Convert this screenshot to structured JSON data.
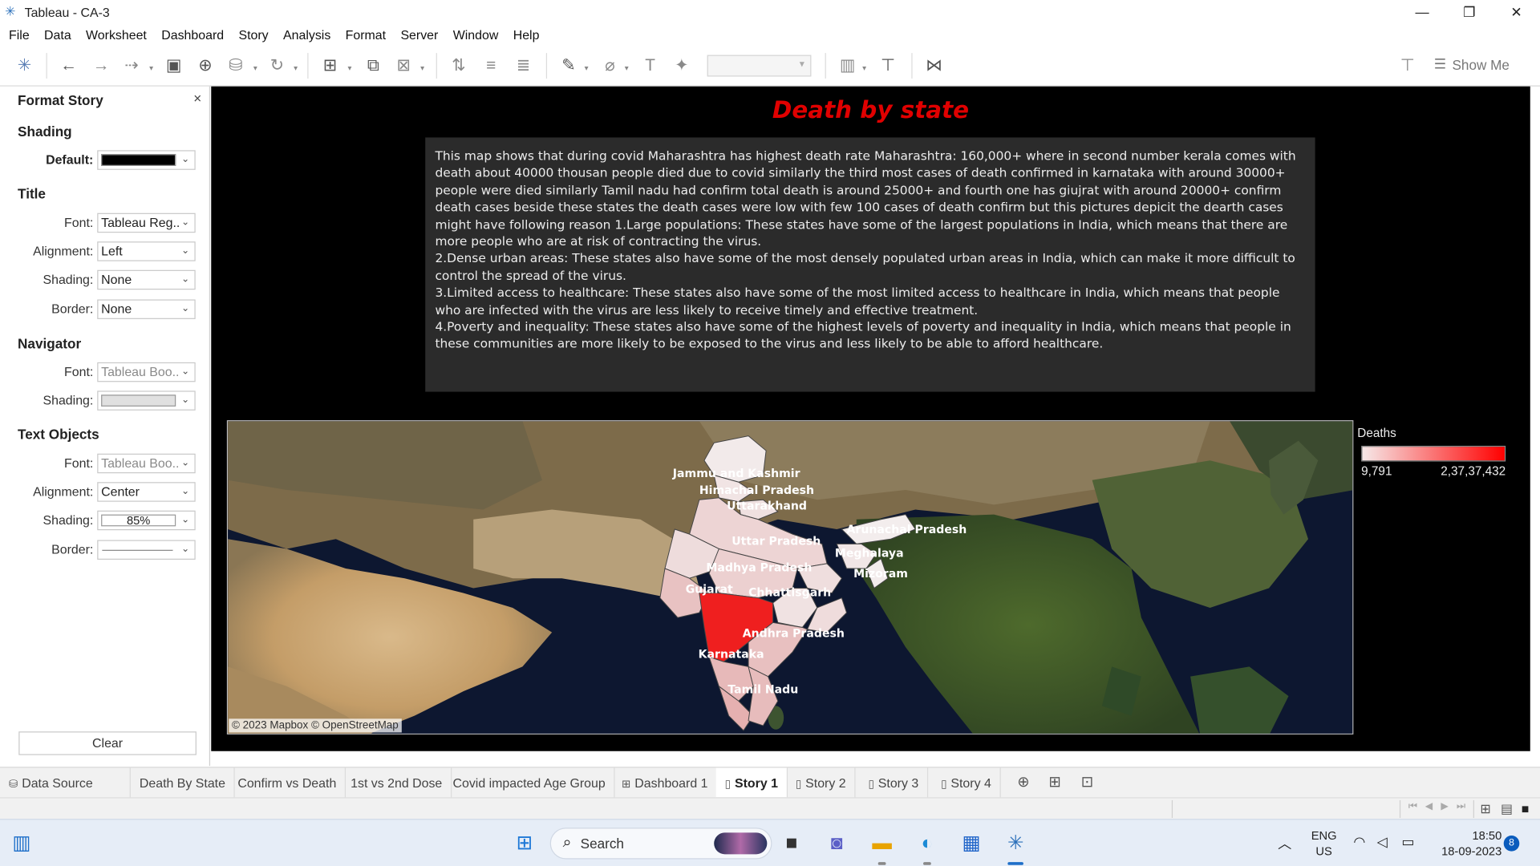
{
  "window": {
    "title": "Tableau - CA-3",
    "controls": [
      "—",
      "❐",
      "✕"
    ]
  },
  "menu": [
    "File",
    "Data",
    "Worksheet",
    "Dashboard",
    "Story",
    "Analysis",
    "Format",
    "Server",
    "Window",
    "Help"
  ],
  "toolbar": {
    "show_me_label": "Show Me"
  },
  "format_pane": {
    "title": "Format Story",
    "close": "×",
    "shading_section": "Shading",
    "default_label": "Default:",
    "default_color": "#000000",
    "title_section": "Title",
    "title_font_label": "Font:",
    "title_font_value": "Tableau Reg..",
    "title_alignment_label": "Alignment:",
    "title_alignment_value": "Left",
    "title_shading_label": "Shading:",
    "title_shading_value": "None",
    "title_border_label": "Border:",
    "title_border_value": "None",
    "navigator_section": "Navigator",
    "nav_font_label": "Font:",
    "nav_font_value": "Tableau Boo..",
    "nav_shading_label": "Shading:",
    "text_section": "Text Objects",
    "text_font_label": "Font:",
    "text_font_value": "Tableau Boo..",
    "text_alignment_label": "Alignment:",
    "text_alignment_value": "Center",
    "text_shading_label": "Shading:",
    "text_shading_value": "85%",
    "text_border_label": "Border:",
    "clear_label": "Clear"
  },
  "story": {
    "title": "Death by state",
    "title_color": "#e00000",
    "text": "This map shows that during covid Maharashtra has highest death rate Maharashtra: 160,000+ where in second number kerala comes with death about 40000 thousan people died due to covid similarly the third most cases of death confirmed in karnataka with around 30000+ people were died similarly Tamil nadu had confirm total death is around 25000+ and fourth one has giujrat with around 20000+ confirm death cases beside these states the death cases were low with few 100  cases of death confirm but this pictures depicit the dearth cases might have following reason 1.Large populations: These states have some of the largest populations in India, which means that there are more people who are at risk of contracting the virus.\n2.Dense urban areas: These states also have some of the most densely populated urban areas in India, which can make it more difficult to control the spread of the virus.\n3.Limited access to healthcare: These states also have some of the most limited access to healthcare in India, which means that people who are infected with the virus are less likely to receive timely and effective treatment.\n4.Poverty and inequality: These states also have some of the highest levels of poverty and inequality in India, which means that people in these communities are more likely to be exposed to the virus and less likely to be able to afford healthcare.",
    "map_credit": "© 2023 Mapbox © OpenStreetMap",
    "legend_title": "Deaths",
    "legend_min": "9,791",
    "legend_max": "2,37,37,432",
    "legend_colors": [
      "#f6e8e8",
      "#ff0000"
    ],
    "states": [
      {
        "name": "Jammu and Kashmir"
      },
      {
        "name": "Himachal Pradesh"
      },
      {
        "name": "Uttarakhand"
      },
      {
        "name": "Uttar Pradesh"
      },
      {
        "name": "Arunachal Pradesh"
      },
      {
        "name": "Meghalaya"
      },
      {
        "name": "Mizoram"
      },
      {
        "name": "Madhya Pradesh"
      },
      {
        "name": "Gujarat"
      },
      {
        "name": "Chhattisgarh"
      },
      {
        "name": "Andhra Pradesh"
      },
      {
        "name": "Karnataka"
      },
      {
        "name": "Tamil Nadu"
      }
    ]
  },
  "tabs": [
    {
      "label": "Data Source",
      "icon": "database-icon"
    },
    {
      "label": "Death By State"
    },
    {
      "label": "Confirm vs Death"
    },
    {
      "label": "1st vs 2nd Dose"
    },
    {
      "label": "Covid impacted Age Group"
    },
    {
      "label": "Dashboard 1",
      "icon": "dashboard-icon"
    },
    {
      "label": "Story 1",
      "icon": "story-icon",
      "active": true
    },
    {
      "label": "Story 2",
      "icon": "story-icon"
    },
    {
      "label": "Story 3",
      "icon": "story-icon"
    },
    {
      "label": "Story 4",
      "icon": "story-icon"
    }
  ],
  "taskbar": {
    "search_label": "Search",
    "lang_top": "ENG",
    "lang_bottom": "US",
    "time": "18:50",
    "date": "18-09-2023",
    "notification_count": "8"
  }
}
